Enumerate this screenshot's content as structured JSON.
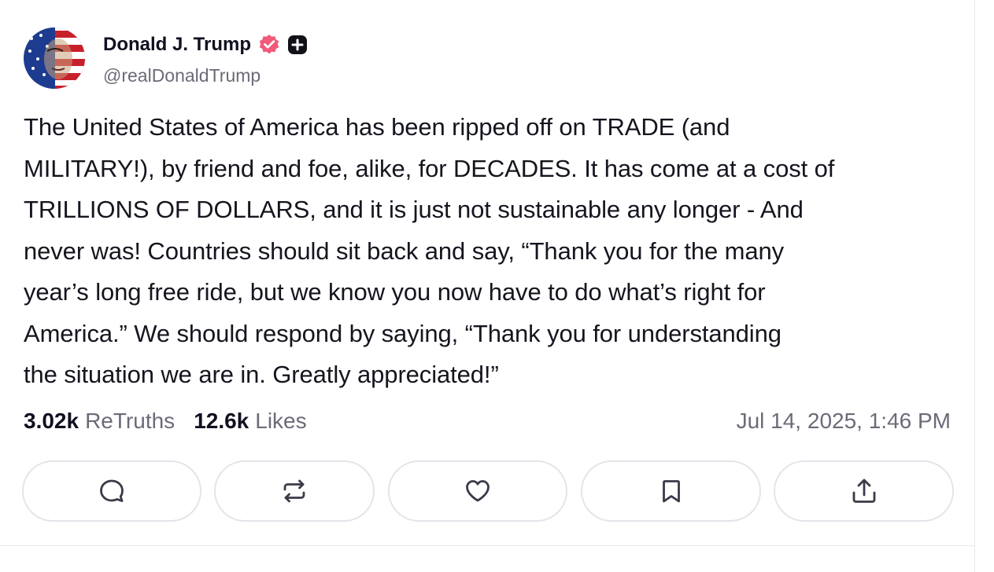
{
  "post": {
    "author": {
      "display_name": "Donald J. Trump",
      "handle": "@realDonaldTrump",
      "verified_icon": "verified-badge-icon",
      "plus_icon": "plus-badge-icon"
    },
    "body": "The United States of America has been ripped off on TRADE (and\nMILITARY!), by friend and foe, alike, for DECADES. It has come at a cost of\nTRILLIONS OF DOLLARS, and it is just not sustainable any longer - And\nnever was! Countries should sit back and say, “Thank you for the many\nyear’s long free ride, but we know you now have to do what’s right for\nAmerica.” We should respond by saying, “Thank you for understanding\nthe situation we are in. Greatly appreciated!”",
    "stats": {
      "retruths_count": "3.02k",
      "retruths_label": "ReTruths",
      "likes_count": "12.6k",
      "likes_label": "Likes"
    },
    "timestamp": "Jul 14, 2025, 1:46 PM"
  },
  "actions": [
    {
      "icon": "reply-icon"
    },
    {
      "icon": "retruth-icon"
    },
    {
      "icon": "heart-icon"
    },
    {
      "icon": "bookmark-icon"
    },
    {
      "icon": "share-icon"
    }
  ],
  "colors": {
    "verified": "#f15a78",
    "text": "#15151f",
    "muted": "#6b6b78",
    "border": "#e4e4ea"
  }
}
